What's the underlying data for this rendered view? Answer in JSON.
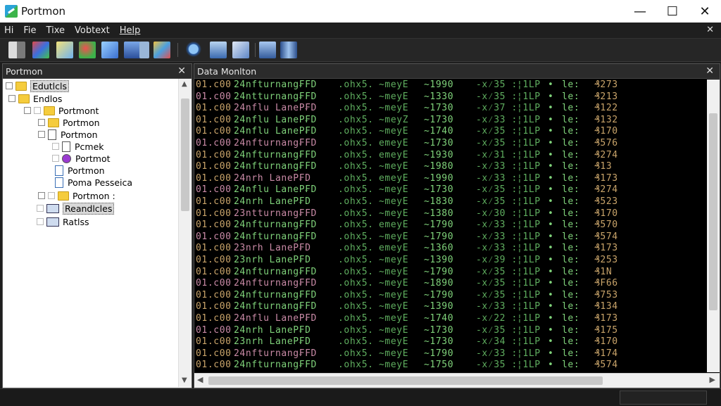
{
  "window": {
    "title": "Portmon",
    "minimize": "—",
    "maximize": "☐",
    "close": "✕"
  },
  "menu": {
    "items": [
      "Hi",
      "Fie",
      "Tixe",
      "Vobtext",
      "Help"
    ],
    "close": "✕"
  },
  "toolbar": {
    "icons": [
      "open-icon",
      "capture-icon",
      "eraser-icon",
      "filter-icon",
      "highlight-icon",
      "connect-icon",
      "options-icon",
      "find-icon",
      "network-icon",
      "mail-icon",
      "save-icon",
      "properties-icon"
    ]
  },
  "left_pane": {
    "title": "Portmon",
    "close": "✕",
    "tree": [
      {
        "label": "Edutlcls",
        "type": "folder",
        "selected": true
      },
      {
        "label": "Endlos",
        "type": "folder"
      },
      {
        "label": "Portmont",
        "type": "folder"
      },
      {
        "label": "Portmon",
        "type": "folder"
      },
      {
        "label": "Portmon",
        "type": "doc"
      },
      {
        "label": "Pcmek",
        "type": "doc"
      },
      {
        "label": "Portmot",
        "type": "purple"
      },
      {
        "label": "Portmon",
        "type": "doc"
      },
      {
        "label": "Poma Pesseica",
        "type": "doc"
      },
      {
        "label": "Portmon :",
        "type": "folder"
      },
      {
        "label": "Reandlcles",
        "type": "list",
        "selected": true
      },
      {
        "label": "Ratlss",
        "type": "list"
      }
    ]
  },
  "right_pane": {
    "title": "Data Monlton",
    "close": "✕",
    "rows": [
      [
        "01.c00",
        "24nfturnang₣FD",
        ".ohx5.",
        "~meyE",
        "~1990",
        "-x⁄35 :",
        "¦1LP",
        "•",
        "le:",
        "₰273"
      ],
      [
        "01.c00",
        "24ntturnang₣FD",
        ".ohx5.",
        "~meyE",
        "~1330",
        "-x⁄35 :",
        "¦1LP",
        "•",
        "le:",
        "₰213"
      ],
      [
        "01.c00",
        "24nflu LaneP₣D",
        ".ohx5.",
        "~meyE",
        "~1730",
        "-x⁄37 :",
        "¦1LP",
        "•",
        "le:",
        "₰122"
      ],
      [
        "01.c00",
        "24nflu LaneP₣D",
        ".ohx5.",
        "~meyZ",
        "~1730",
        "-x⁄33 :",
        "¦1LP",
        "•",
        "le:",
        "₰132"
      ],
      [
        "01.c00",
        "24nflu LaneP₣D",
        ".ohx5.",
        "~meyE",
        "~1740",
        "-x⁄35 :",
        "¦1LP",
        "•",
        "le:",
        "₰170"
      ],
      [
        "01.c00",
        "24nfturnang₣FD",
        ".ohx5.",
        "emeyE",
        "~1730",
        "-x⁄35 :",
        "¦1LP",
        "•",
        "le:",
        "₰576"
      ],
      [
        "01.c00",
        "24nfturnang₣FD",
        ".ohx5.",
        "emeyE",
        "~1930",
        "-x⁄31 :",
        "¦1LP",
        "•",
        "le:",
        "₰274"
      ],
      [
        "01.c00",
        "24nfturnang₣FD",
        ".ohx5.",
        "~meyE",
        "~1980",
        "-x⁄33 :",
        "¦1LP",
        "•",
        "le:",
        "₰13"
      ],
      [
        "01.c00",
        "24nrh LaneP₣D",
        ".ohx5.",
        "emeyE",
        "~1990",
        "-x⁄33 :",
        "¦1LP",
        "•",
        "le:",
        "₰173"
      ],
      [
        "01.c00",
        "24nflu LaneP₣D",
        ".ohx5.",
        "~meyE",
        "~1730",
        "-x⁄35 :",
        "¦1LP",
        "•",
        "le:",
        "₰274"
      ],
      [
        "01.c00",
        "24nrh LaneP₣D",
        ".ohx5.",
        "~meyE",
        "~1830",
        "-x⁄35 :",
        "¦1LP",
        "•",
        "le:",
        "₰523"
      ],
      [
        "01.c00",
        "23ntturnang₣FD",
        ".ohx5.",
        "~meyE",
        "~1380",
        "-x⁄30 :",
        "¦1LP",
        "•",
        "le:",
        "₰170"
      ],
      [
        "01.c00",
        "24nfturnang₣FD",
        ".ohx5.",
        "emeyE",
        "~1790",
        "-x⁄33 :",
        "¦1LP",
        "•",
        "le:",
        "₰570"
      ],
      [
        "01.c00",
        "24nfturnang₣FD",
        ".ohx5.",
        "~meyE",
        "~1790",
        "-x⁄33 :",
        "¦1LP",
        "•",
        "le:",
        "₰574"
      ],
      [
        "01.c00",
        "23nrh LaneP₣D",
        ".ohx5.",
        "emeyE",
        "~1360",
        "-x⁄33 :",
        "¦1LP",
        "•",
        "le:",
        "₰173"
      ],
      [
        "01.c00",
        "23nrh LaneP₣D",
        ".ohx5.",
        "~meyE",
        "~1390",
        "-x⁄39 :",
        "¦1LP",
        "•",
        "le:",
        "₰253"
      ],
      [
        "01.c00",
        "24nfturnang₣FD",
        ".ohx5.",
        "~meyE",
        "~1790",
        "-x⁄35 :",
        "¦1LP",
        "•",
        "le:",
        "₰1N"
      ],
      [
        "01.c00",
        "24nfturnang₣FD",
        ".ohx5.",
        "~meyE",
        "~1890",
        "-x⁄35 :",
        "¦1LP",
        "•",
        "le:",
        "₰F66"
      ],
      [
        "01.c00",
        "24nfturnang₣FD",
        ".ohx5.",
        "~meyE",
        "~1790",
        "-x⁄35 :",
        "¦1LP",
        "•",
        "le:",
        "₰753"
      ],
      [
        "01.c00",
        "24nfturnang₣FD",
        ".ohx5.",
        "~meyE",
        "~1390",
        "-x⁄33 :",
        "¦1LP",
        "•",
        "le:",
        "₰134"
      ],
      [
        "01.c00",
        "24nflu LaneP₣D",
        ".ohx5.",
        "~meyE",
        "~1740",
        "-x⁄22 :",
        "¦1LP",
        "•",
        "le:",
        "₰173"
      ],
      [
        "01.c00",
        "24nrh LaneP₣D",
        ".ohx5.",
        "~meyE",
        "~1730",
        "-x⁄35 :",
        "¦1LP",
        "•",
        "le:",
        "₰175"
      ],
      [
        "01.c00",
        "23nrh LaneP₣D",
        ".ohx5.",
        "~meyE",
        "~1730",
        "-x⁄34 :",
        "¦1LP",
        "•",
        "le:",
        "₰170"
      ],
      [
        "01.c00",
        "24nfturnang₣FD",
        ".ohx5.",
        "~meyE",
        "~1790",
        "-x⁄33 :",
        "¦1LP",
        "•",
        "le:",
        "₰174"
      ],
      [
        "01.c00",
        "24nfturnang₣FD",
        ".ohx5.",
        "~meyE",
        "~1750",
        "-x⁄35 :",
        "¦1LP",
        "•",
        "le:",
        "₰574"
      ]
    ]
  },
  "colors": {
    "bright": "#7fd27a",
    "dim": "#5fae5f",
    "amber": "#c9a46a",
    "mauve": "#c98aa6"
  }
}
